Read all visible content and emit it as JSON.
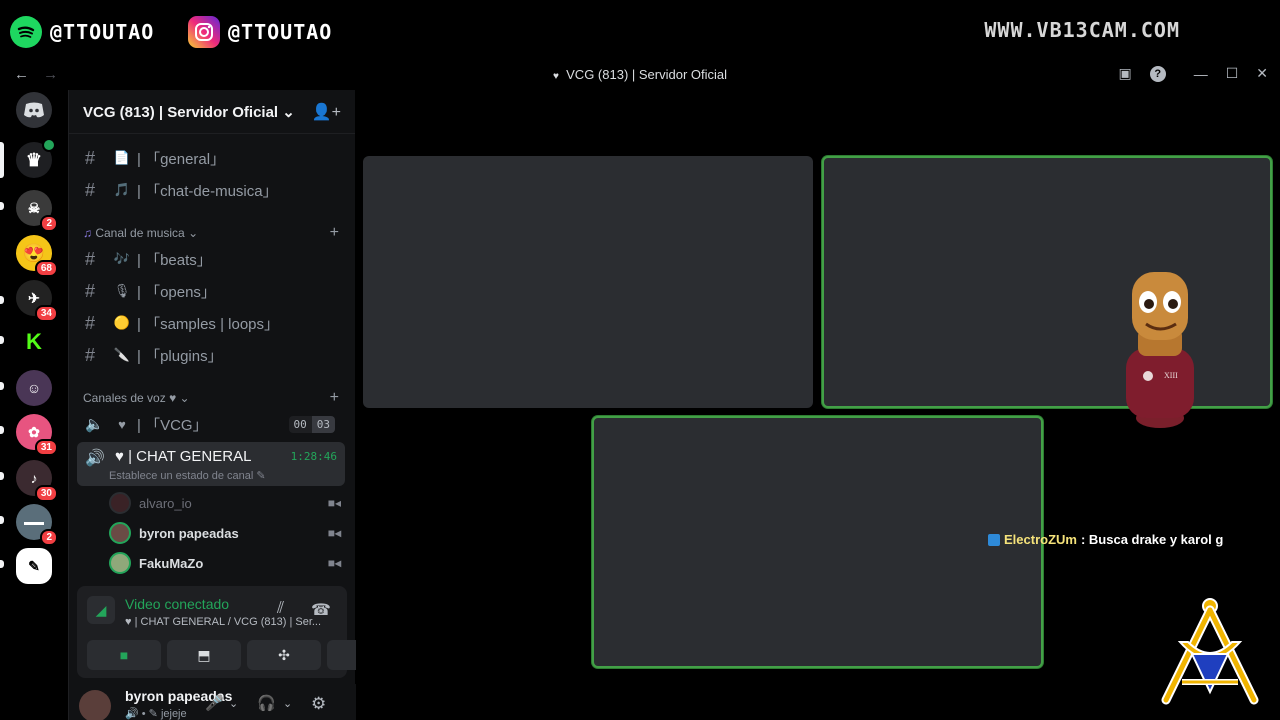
{
  "overlay": {
    "spotify_handle": "@TTOUTAO",
    "instagram_handle": "@TTOUTAO",
    "website": "WWW.VB13CAM.COM"
  },
  "titlebar": {
    "back": "←",
    "forward": "→",
    "title": "VCG (813) | Servidor Oficial"
  },
  "rail": {
    "badges": [
      "2",
      "68",
      "34",
      "31",
      "30",
      "2"
    ]
  },
  "server": {
    "name": "VCG (813) | Servidor Oficial",
    "channels_top": [
      {
        "emoji": "📄",
        "label": "| 「general」"
      },
      {
        "emoji": "🎵",
        "label": "| 「chat-de-musica」"
      }
    ],
    "music_category": "Canal de musica",
    "music_channels": [
      {
        "emoji": "🎶",
        "label": "| 「beats」"
      },
      {
        "emoji": "🎙",
        "label": "| 「opens」"
      },
      {
        "emoji": "🟡",
        "label": "| 「samples | loops」"
      },
      {
        "emoji": "🔪",
        "label": "| 「plugins」"
      }
    ],
    "voice_category": "Canales de voz",
    "voice_channel_1": "| 「VCG」",
    "voice_channel_1_count_a": "00",
    "voice_channel_1_count_b": "03",
    "active_voice_channel": "| CHAT GENERAL",
    "active_voice_status": "Establece un estado de canal",
    "active_voice_time": "1:28:46",
    "voice_users": [
      "alvaro_io",
      "byron papeadas",
      "FakuMaZo"
    ]
  },
  "voice_panel": {
    "status": "Video conectado",
    "subtitle": "| CHAT GENERAL / VCG (813) | Ser..."
  },
  "user_panel": {
    "name": "byron papeadas",
    "status": "jejeje"
  },
  "chat_overlay": {
    "user": "ElectroZUm",
    "message": ": Busca drake y karol g"
  },
  "colors": {
    "accent_green": "#23a55a",
    "tile": "#2b2d31",
    "sidebar": "#111214",
    "badge_red": "#f23f43"
  }
}
